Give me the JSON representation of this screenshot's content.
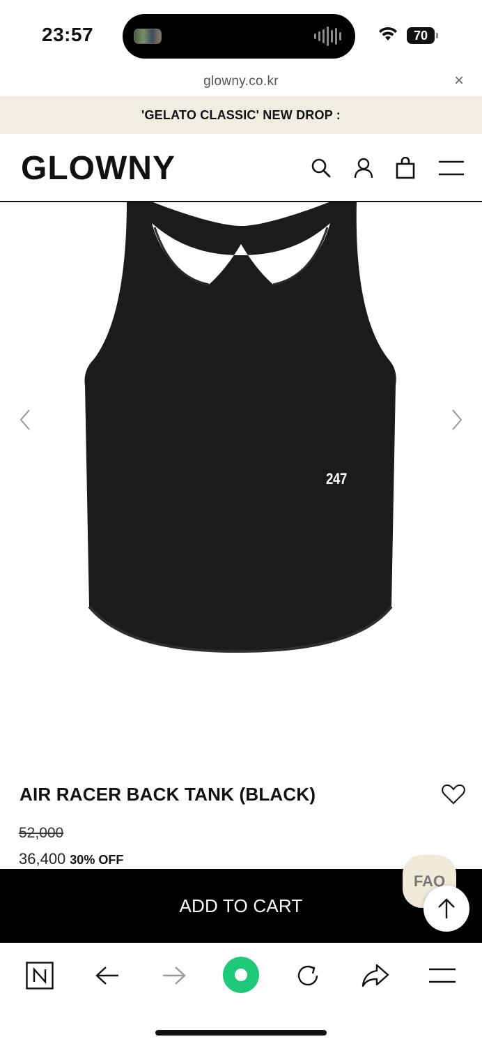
{
  "status_bar": {
    "time": "23:57",
    "battery": "70",
    "icons": [
      "wifi-icon",
      "battery-icon"
    ]
  },
  "browser": {
    "url": "glowny.co.kr",
    "close_label": "×"
  },
  "announcement": {
    "text": "'GELATO CLASSIC' NEW DROP :"
  },
  "header": {
    "logo": "GLOWNY",
    "icons": [
      "search-icon",
      "account-icon",
      "shopping-bag-icon",
      "menu-icon"
    ]
  },
  "product": {
    "image_print": "247",
    "name": "AIR RACER BACK TANK (BLACK)",
    "original_price": "52,000",
    "sale_price": "36,400",
    "discount": "30% OFF"
  },
  "actions": {
    "add_to_cart": "ADD TO CART",
    "faq": "FAQ"
  },
  "toolbar": {
    "icons": [
      "naver-home-icon",
      "back-arrow-icon",
      "forward-arrow-icon",
      "green-dot-icon",
      "reload-icon",
      "share-icon",
      "menu-icon"
    ]
  },
  "colors": {
    "announcement_bg": "#f2ede2",
    "cart_bar": "#000000",
    "faq_bg": "#f0ead9",
    "accent_green": "#1ec97a"
  }
}
